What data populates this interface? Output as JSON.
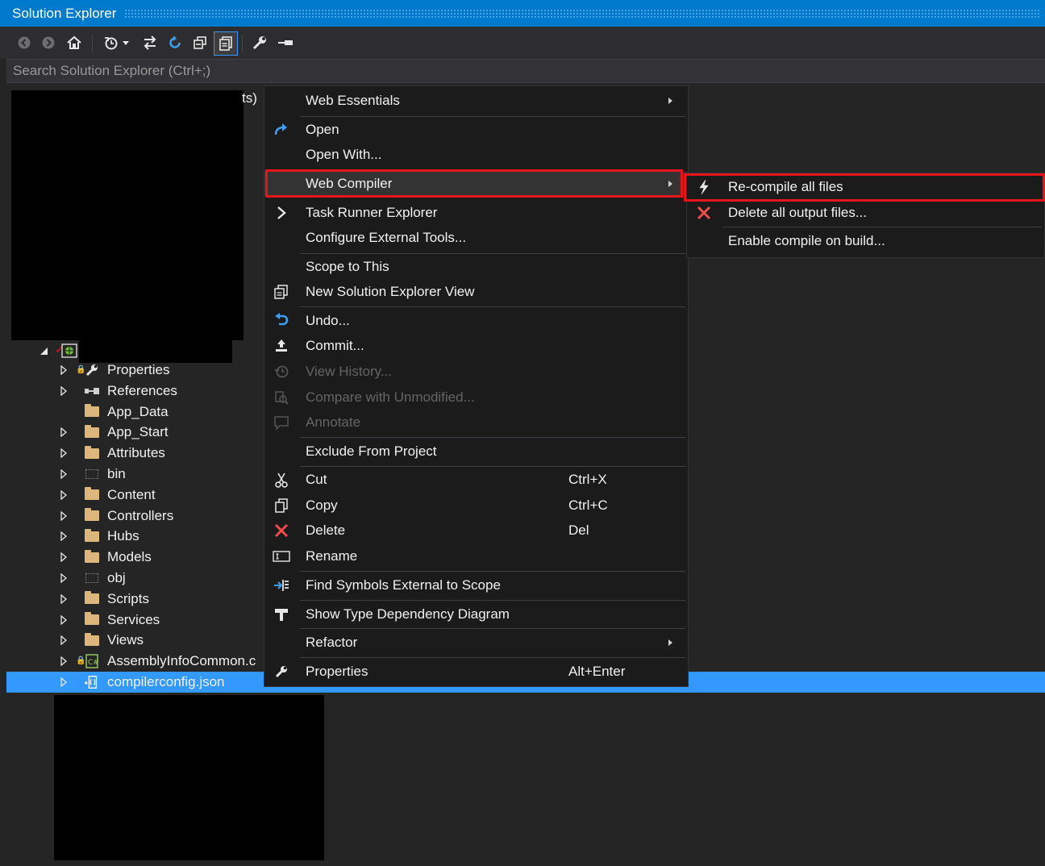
{
  "window": {
    "title": "Solution Explorer"
  },
  "search": {
    "placeholder": "Search Solution Explorer (Ctrl+;)"
  },
  "toolbar": {
    "icons": [
      "back-icon",
      "forward-icon",
      "home-icon",
      "history-icon",
      "sync-icon",
      "refresh-icon",
      "collapse-all-icon",
      "show-all-files-icon",
      "properties-icon",
      "pin-icon"
    ]
  },
  "tree": {
    "partial_text": "ts)",
    "items": [
      {
        "label": "Properties",
        "icon": "wrench-icon"
      },
      {
        "label": "References",
        "icon": "references-icon"
      },
      {
        "label": "App_Data",
        "icon": "folder-icon"
      },
      {
        "label": "App_Start",
        "icon": "folder-icon"
      },
      {
        "label": "Attributes",
        "icon": "folder-icon"
      },
      {
        "label": "bin",
        "icon": "dotted-folder-icon"
      },
      {
        "label": "Content",
        "icon": "folder-icon"
      },
      {
        "label": "Controllers",
        "icon": "folder-icon"
      },
      {
        "label": "Hubs",
        "icon": "folder-icon"
      },
      {
        "label": "Models",
        "icon": "folder-icon"
      },
      {
        "label": "obj",
        "icon": "dotted-folder-icon"
      },
      {
        "label": "Scripts",
        "icon": "folder-icon"
      },
      {
        "label": "Services",
        "icon": "folder-icon"
      },
      {
        "label": "Views",
        "icon": "folder-icon"
      },
      {
        "label": "AssemblyInfoCommon.c",
        "icon": "csharp-file-icon"
      },
      {
        "label": "compilerconfig.json",
        "icon": "json-file-icon",
        "selected": true
      }
    ]
  },
  "menu": {
    "items": [
      {
        "label": "Web Essentials",
        "submenu": true
      },
      {
        "label": "Open",
        "icon": "open-icon"
      },
      {
        "label": "Open With..."
      },
      {
        "label": "Web Compiler",
        "submenu": true
      },
      {
        "label": "Task Runner Explorer",
        "icon": "chevron-right-icon"
      },
      {
        "label": "Configure External Tools..."
      },
      {
        "label": "Scope to This"
      },
      {
        "label": "New Solution Explorer View",
        "icon": "new-view-icon"
      },
      {
        "label": "Undo...",
        "icon": "undo-icon"
      },
      {
        "label": "Commit...",
        "icon": "commit-icon"
      },
      {
        "label": "View History...",
        "icon": "history-icon",
        "disabled": true
      },
      {
        "label": "Compare with Unmodified...",
        "icon": "compare-icon",
        "disabled": true
      },
      {
        "label": "Annotate",
        "icon": "annotate-icon",
        "disabled": true
      },
      {
        "label": "Exclude From Project"
      },
      {
        "label": "Cut",
        "icon": "scissors-icon",
        "shortcut": "Ctrl+X"
      },
      {
        "label": "Copy",
        "icon": "copy-icon",
        "shortcut": "Ctrl+C"
      },
      {
        "label": "Delete",
        "icon": "delete-icon",
        "shortcut": "Del"
      },
      {
        "label": "Rename",
        "icon": "rename-icon"
      },
      {
        "label": "Find Symbols External to Scope",
        "icon": "find-symbols-icon"
      },
      {
        "label": "Show Type Dependency Diagram",
        "icon": "type-diagram-icon"
      },
      {
        "label": "Refactor",
        "submenu": true
      },
      {
        "label": "Properties",
        "icon": "wrench-icon",
        "shortcut": "Alt+Enter"
      }
    ]
  },
  "submenu": {
    "items": [
      {
        "label": "Re-compile all files",
        "icon": "lightning-icon"
      },
      {
        "label": "Delete all output files...",
        "icon": "delete-icon"
      },
      {
        "label": "Enable compile on build..."
      }
    ]
  },
  "colors": {
    "title_bar": "#007acc",
    "selection": "#3399ff",
    "highlight_box": "#e8141b",
    "folder": "#dcb67a",
    "delete_red": "#f14c4c"
  }
}
